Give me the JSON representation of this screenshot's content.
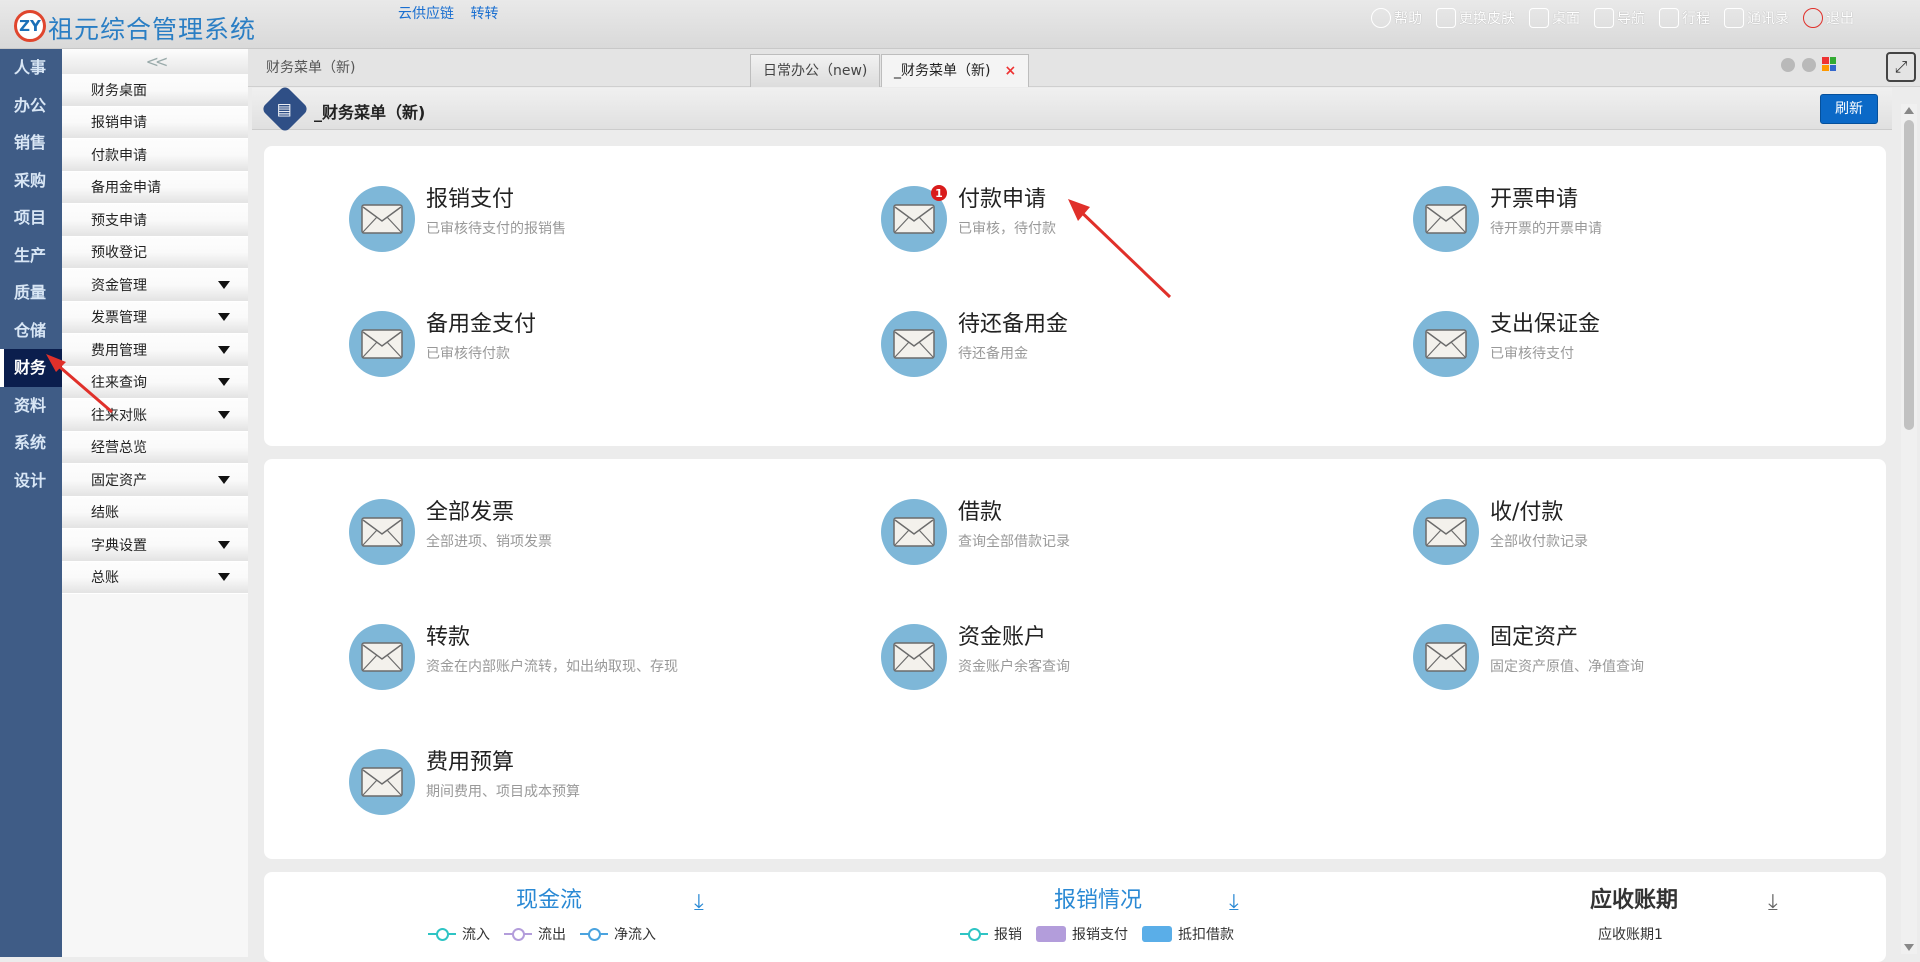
{
  "app": {
    "title": "祖元综合管理系统",
    "logo_text": "ZY"
  },
  "top_links": [
    "云供应链",
    "转转"
  ],
  "top_right": [
    {
      "label": "帮助",
      "icon": "help-icon"
    },
    {
      "label": "更换皮肤",
      "icon": "shirt-icon"
    },
    {
      "label": "桌面",
      "icon": "home-icon"
    },
    {
      "label": "导航",
      "icon": "grid-icon"
    },
    {
      "label": "行程",
      "icon": "calendar-icon"
    },
    {
      "label": "通讯录",
      "icon": "contacts-icon"
    },
    {
      "label": "退出",
      "icon": "power-icon"
    }
  ],
  "left_nav": {
    "items": [
      "人事",
      "办公",
      "销售",
      "采购",
      "项目",
      "生产",
      "质量",
      "仓储",
      "财务",
      "资料",
      "系统",
      "设计"
    ],
    "active": "财务"
  },
  "submenu": {
    "collapse_glyph": "<<",
    "items": [
      {
        "label": "财务桌面",
        "dropdown": false
      },
      {
        "label": "报销申请",
        "dropdown": false
      },
      {
        "label": "付款申请",
        "dropdown": false
      },
      {
        "label": "备用金申请",
        "dropdown": false
      },
      {
        "label": "预支申请",
        "dropdown": false
      },
      {
        "label": "预收登记",
        "dropdown": false
      },
      {
        "label": "资金管理",
        "dropdown": true
      },
      {
        "label": "发票管理",
        "dropdown": true
      },
      {
        "label": "费用管理",
        "dropdown": true
      },
      {
        "label": "往来查询",
        "dropdown": true
      },
      {
        "label": "往来对账",
        "dropdown": true
      },
      {
        "label": "经营总览",
        "dropdown": false
      },
      {
        "label": "固定资产",
        "dropdown": true
      },
      {
        "label": "结账",
        "dropdown": false
      },
      {
        "label": "字典设置",
        "dropdown": true
      },
      {
        "label": "总账",
        "dropdown": true
      }
    ]
  },
  "tabs": {
    "breadcrumb": "财务菜单（新)",
    "items": [
      {
        "label": "日常办公（new)",
        "active": false
      },
      {
        "label": "_财务菜单（新)",
        "active": true
      }
    ],
    "close_glyph": "×"
  },
  "header": {
    "title": "_财务菜单（新)",
    "refresh_label": "刷新",
    "icon_glyph": "▤"
  },
  "cards_panel1": [
    {
      "title": "报销支付",
      "subtitle": "已审核待支付的报销售",
      "badge": null
    },
    {
      "title": "付款申请",
      "subtitle": "已审核，待付款",
      "badge": "1"
    },
    {
      "title": "开票申请",
      "subtitle": "待开票的开票申请",
      "badge": null
    },
    {
      "title": "备用金支付",
      "subtitle": "已审核待付款",
      "badge": null
    },
    {
      "title": "待还备用金",
      "subtitle": "待还备用金",
      "badge": null
    },
    {
      "title": "支出保证金",
      "subtitle": "已审核待支付",
      "badge": null
    }
  ],
  "cards_panel2": [
    {
      "title": "全部发票",
      "subtitle": "全部进项、销项发票"
    },
    {
      "title": "借款",
      "subtitle": "查询全部借款记录"
    },
    {
      "title": "收/付款",
      "subtitle": "全部收付款记录"
    },
    {
      "title": "转款",
      "subtitle": "资金在内部账户流转，如出纳取现、存现"
    },
    {
      "title": "资金账户",
      "subtitle": "资金账户余客查询"
    },
    {
      "title": "固定资产",
      "subtitle": "固定资产原值、净值查询"
    },
    {
      "title": "费用预算",
      "subtitle": "期间费用、项目成本预算"
    }
  ],
  "charts": [
    {
      "title": "现金流",
      "legend": [
        {
          "name": "流入",
          "color": "#2ec4c4",
          "kind": "line"
        },
        {
          "name": "流出",
          "color": "#b39ddb",
          "kind": "line"
        },
        {
          "name": "净流入",
          "color": "#4aa3df",
          "kind": "line"
        }
      ]
    },
    {
      "title": "报销情况",
      "legend": [
        {
          "name": "报销",
          "color": "#2ec4c4",
          "kind": "line"
        },
        {
          "name": "报销支付",
          "color": "#b39ddb",
          "kind": "box"
        },
        {
          "name": "抵扣借款",
          "color": "#5aaee8",
          "kind": "box"
        }
      ]
    },
    {
      "title": "应收账期",
      "subtitle": "应收账期1"
    }
  ],
  "colors": {
    "nav_bg": "#3f5c86",
    "nav_active": "#0b1e4d",
    "accent": "#0b69c7",
    "envelope_circle": "#7eb7d8",
    "badge": "#d91c1c",
    "annotation_arrow": "#e0302a"
  }
}
